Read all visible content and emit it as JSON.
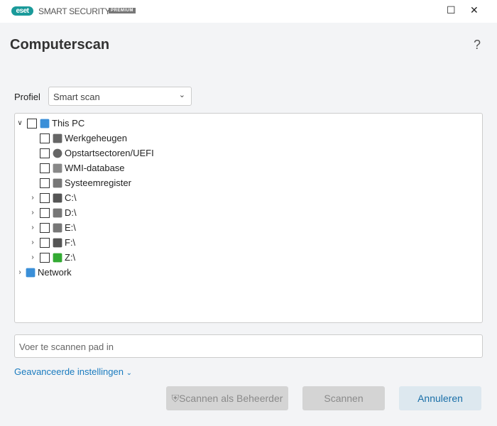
{
  "titlebar": {
    "logo": "eset",
    "brand": "SMART SECURITY",
    "edition": "PREMIUM",
    "minimize": "☐",
    "close": "✕"
  },
  "header": {
    "title": "Computerscan",
    "help": "?"
  },
  "profile": {
    "label": "Profiel",
    "value": "Smart scan"
  },
  "tree": [
    {
      "label": "This PC",
      "level": 0,
      "expand": "expanded",
      "icon": "computer-icon"
    },
    {
      "label": "Werkgeheugen",
      "level": 1,
      "expand": "none",
      "icon": "memory-icon"
    },
    {
      "label": "Opstartsectoren/UEFI",
      "level": 1,
      "expand": "none",
      "icon": "disc-icon"
    },
    {
      "label": "WMI-database",
      "level": 1,
      "expand": "none",
      "icon": "wmi-icon"
    },
    {
      "label": "Systeemregister",
      "level": 1,
      "expand": "none",
      "icon": "registry-icon"
    },
    {
      "label": "C:\\",
      "level": 1,
      "expand": "collapsed",
      "icon": "system-drive-icon"
    },
    {
      "label": "D:\\",
      "level": 1,
      "expand": "collapsed",
      "icon": "optical-drive-icon"
    },
    {
      "label": "E:\\",
      "level": 1,
      "expand": "collapsed",
      "icon": "optical-drive-icon"
    },
    {
      "label": "F:\\",
      "level": 1,
      "expand": "collapsed",
      "icon": "drive-icon"
    },
    {
      "label": "Z:\\",
      "level": 1,
      "expand": "collapsed",
      "icon": "network-drive-icon"
    },
    {
      "label": "Network",
      "level": -1,
      "expand": "collapsed",
      "icon": "network-icon"
    }
  ],
  "path_input": {
    "placeholder": "Voer te scannen pad in"
  },
  "advanced": "Geavanceerde instellingen",
  "buttons": {
    "admin": "Scannen als Beheerder",
    "scan": "Scannen",
    "cancel": "Annuleren"
  }
}
